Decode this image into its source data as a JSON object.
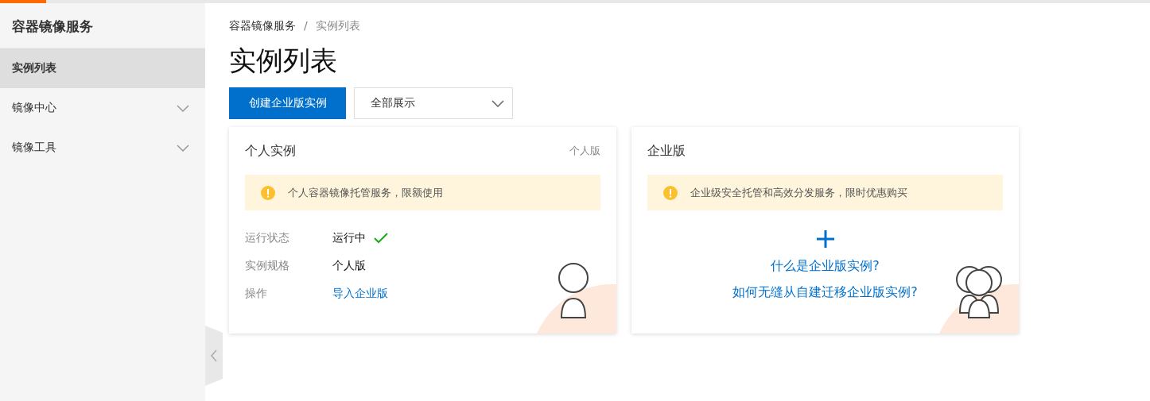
{
  "loading_bar": {
    "level": 0.04
  },
  "sidebar": {
    "title": "容器镜像服务",
    "items": [
      {
        "label": "实例列表",
        "selected": true,
        "expandable": false
      },
      {
        "label": "镜像中心",
        "selected": false,
        "expandable": true
      },
      {
        "label": "镜像工具",
        "selected": false,
        "expandable": true
      }
    ]
  },
  "breadcrumb": [
    "容器镜像服务",
    "/",
    "实例列表"
  ],
  "page_title": "实例列表",
  "toolbar": {
    "create_button": "创建企业版实例",
    "filter": {
      "value": "全部展示"
    }
  },
  "cards": [
    {
      "kind": "personal",
      "title": "个人实例",
      "badge": "个人版",
      "notice": "个人容器镜像托管服务，限额使用",
      "fields": [
        {
          "label": "运行状态",
          "value": "运行中",
          "kind": "status"
        },
        {
          "label": "实例规格",
          "value": "个人版",
          "kind": "text"
        },
        {
          "label": "操作",
          "value": "导入企业版",
          "kind": "link"
        }
      ]
    },
    {
      "kind": "enterprise",
      "title": "企业版",
      "notice": "企业级安全托管和高效分发服务，限时优惠购买",
      "links": [
        "什么是企业版实例?",
        "如何无缝从自建迁移企业版实例?"
      ]
    }
  ]
}
